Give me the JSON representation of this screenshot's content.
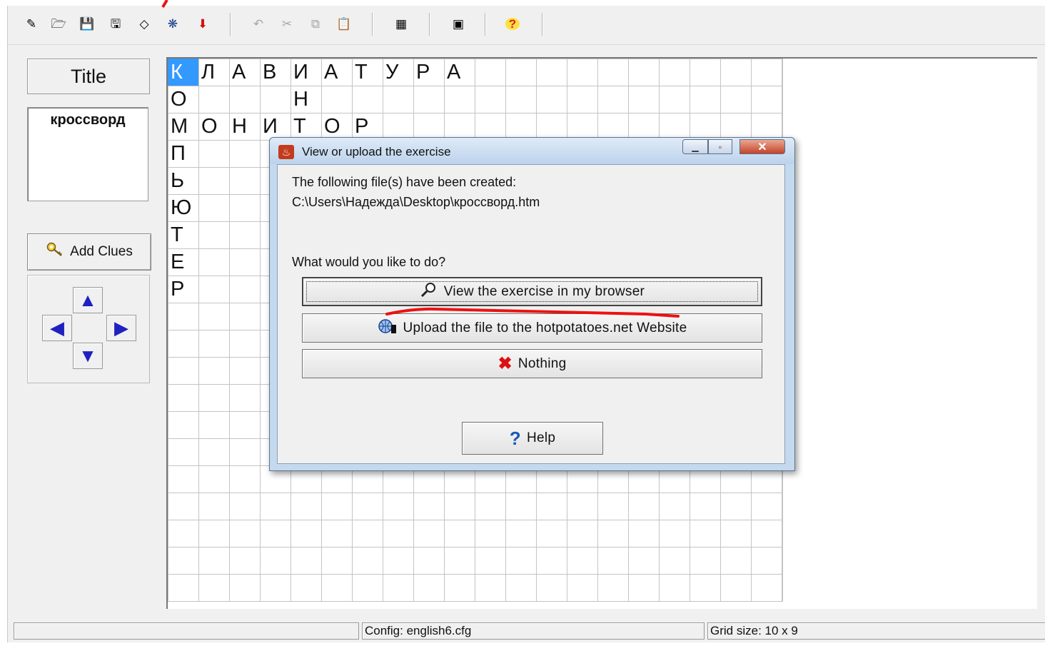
{
  "toolbar": {
    "buttons": [
      {
        "icon": "new-file-icon",
        "glyph": "✎",
        "enabled": true
      },
      {
        "icon": "open-folder-icon",
        "glyph": "🗁",
        "enabled": true
      },
      {
        "icon": "save-icon",
        "glyph": "💾",
        "enabled": true
      },
      {
        "icon": "save-as-icon",
        "glyph": "🖫",
        "enabled": true
      },
      {
        "icon": "eraser-icon",
        "glyph": "◇",
        "enabled": true
      },
      {
        "icon": "web-export-icon",
        "glyph": "❋",
        "enabled": true
      },
      {
        "icon": "red-down-arrow-icon",
        "glyph": "⬇",
        "enabled": true
      },
      {
        "icon": "undo-icon",
        "glyph": "↶",
        "enabled": false
      },
      {
        "icon": "cut-icon",
        "glyph": "✂",
        "enabled": false
      },
      {
        "icon": "copy-icon",
        "glyph": "⧉",
        "enabled": false
      },
      {
        "icon": "paste-icon",
        "glyph": "📋",
        "enabled": false
      },
      {
        "icon": "grid-icon",
        "glyph": "▦",
        "enabled": true
      },
      {
        "icon": "screen-icon",
        "glyph": "▣",
        "enabled": true
      },
      {
        "icon": "help-icon",
        "glyph": "?",
        "enabled": true
      }
    ]
  },
  "sidebar": {
    "title_label": "Title",
    "title_value": "кроссворд",
    "add_clues_label": "Add Clues"
  },
  "grid": {
    "rows": [
      [
        "К",
        "Л",
        "А",
        "В",
        "И",
        "А",
        "Т",
        "У",
        "Р",
        "А"
      ],
      [
        "О",
        "",
        "",
        "",
        "Н",
        "",
        "",
        "",
        "",
        ""
      ],
      [
        "М",
        "О",
        "Н",
        "И",
        "Т",
        "О",
        "Р",
        "",
        "",
        ""
      ],
      [
        "П",
        "",
        "",
        "",
        "",
        "",
        "",
        "",
        "",
        ""
      ],
      [
        "Ь",
        "",
        "",
        "",
        "",
        "",
        "",
        "",
        "",
        ""
      ],
      [
        "Ю",
        "",
        "",
        "",
        "",
        "",
        "",
        "",
        "",
        ""
      ],
      [
        "Т",
        "",
        "",
        "",
        "",
        "",
        "",
        "",
        "",
        ""
      ],
      [
        "Е",
        "",
        "",
        "",
        "",
        "",
        "",
        "",
        "",
        ""
      ],
      [
        "Р",
        "",
        "",
        "",
        "",
        "",
        "",
        "",
        "",
        ""
      ]
    ],
    "selected": [
      0,
      0
    ]
  },
  "status": {
    "config": "Config: english6.cfg",
    "grid_size": "Grid size: 10 x 9"
  },
  "dialog": {
    "title": "View or upload the exercise",
    "created_text": "The following file(s) have been created:",
    "file_path": "C:\\Users\\Надежда\\Desktop\\кроссворд.htm",
    "question": "What would you like to do?",
    "view_button": "View the exercise in my browser",
    "upload_button": "Upload the file to the hotpotatoes.net Website",
    "nothing_button": "Nothing",
    "help_button": "Help"
  }
}
